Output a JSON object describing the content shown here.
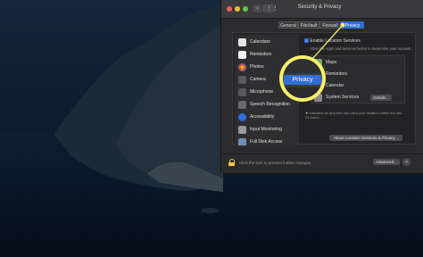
{
  "window": {
    "title": "Security & Privacy",
    "tabs": [
      {
        "label": "General"
      },
      {
        "label": "FileVault"
      },
      {
        "label": "Firewall"
      },
      {
        "label": "Privacy"
      }
    ],
    "sidebar": {
      "items": [
        {
          "label": "Calendars"
        },
        {
          "label": "Reminders"
        },
        {
          "label": "Photos"
        },
        {
          "label": "Camera"
        },
        {
          "label": "Microphone"
        },
        {
          "label": "Speech Recognition"
        },
        {
          "label": "Accessibility"
        },
        {
          "label": "Input Monitoring"
        },
        {
          "label": "Full Disk Access"
        }
      ]
    },
    "main": {
      "enable_label": "Enable Location Services",
      "enable_desc": "Allow the apps and services below to determine your location.",
      "list": [
        {
          "label": "Maps"
        },
        {
          "label": "Reminders"
        },
        {
          "label": "Calendar"
        },
        {
          "label": "System Services"
        }
      ],
      "details_label": "Details...",
      "indicator_note": "Indicates an app that has used your location within the last 24 hours.",
      "about_button": "About Location Services & Privacy..."
    },
    "bottom": {
      "lock_text": "Click the lock to prevent further changes.",
      "advanced": "Advanced...",
      "help": "?"
    }
  },
  "callout": {
    "label": "Privacy"
  },
  "colors": {
    "accent": "#2f6fd6",
    "highlight": "#f6f06a"
  }
}
